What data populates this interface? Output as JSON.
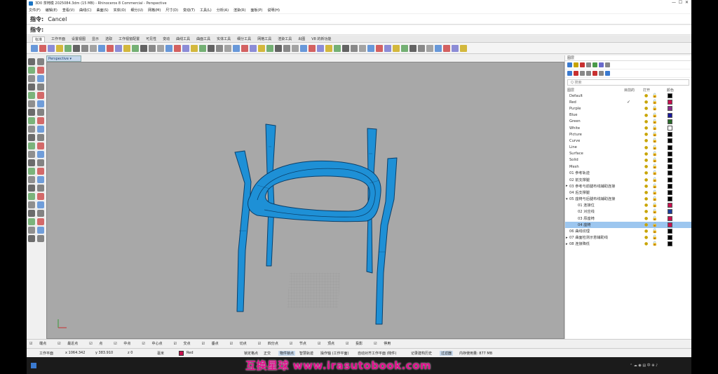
{
  "window": {
    "title": "3D0 茶椅模 2025084.3dm (15 MB) - Rhinoceros 8 Commercial - Perspective"
  },
  "menu": [
    "文件(F)",
    "编辑(E)",
    "查看(V)",
    "曲线(C)",
    "曲面(S)",
    "实体(O)",
    "细分(U)",
    "网格(M)",
    "尺寸(D)",
    "变动(T)",
    "工具(L)",
    "分析(A)",
    "渲染(R)",
    "面板(P)",
    "说明(H)"
  ],
  "command": {
    "label1": "指令:",
    "value1": "Cancel",
    "label2": "指令:"
  },
  "tabs": [
    "标准",
    "工作平面",
    "设置视图",
    "显示",
    "选取",
    "工作视窗配置",
    "可见性",
    "变动",
    "曲线工具",
    "曲面工具",
    "实体工具",
    "细分工具",
    "网格工具",
    "渲染工具",
    "出图",
    "V8 的新功能"
  ],
  "viewport": {
    "name": "Perspective"
  },
  "panel": {
    "tabs": "图层",
    "search_placeholder": "Q 搜索",
    "headers": {
      "name": "图层",
      "current": "目前的",
      "onoff": "打开",
      "color": "颜色"
    },
    "layers": [
      {
        "name": "Default",
        "current": "",
        "color": "#000000",
        "indent": 0,
        "selected": false
      },
      {
        "name": "Red",
        "current": "✓",
        "color": "#c8104e",
        "indent": 0,
        "selected": false
      },
      {
        "name": "Purple",
        "current": "",
        "color": "#8a2b8a",
        "indent": 0,
        "selected": false
      },
      {
        "name": "Blue",
        "current": "",
        "color": "#1a1a9a",
        "indent": 0,
        "selected": false
      },
      {
        "name": "Green",
        "current": "",
        "color": "#2a6a2a",
        "indent": 0,
        "selected": false
      },
      {
        "name": "White",
        "current": "",
        "color": "#ffffff",
        "indent": 0,
        "selected": false
      },
      {
        "name": "Picture",
        "current": "",
        "color": "#000000",
        "indent": 0,
        "selected": false
      },
      {
        "name": "Curve",
        "current": "",
        "color": "#000000",
        "indent": 0,
        "selected": false
      },
      {
        "name": "Line",
        "current": "",
        "color": "#000000",
        "indent": 0,
        "selected": false
      },
      {
        "name": "Surface",
        "current": "",
        "color": "#000000",
        "indent": 0,
        "selected": false
      },
      {
        "name": "Solid",
        "current": "",
        "color": "#000000",
        "indent": 0,
        "selected": false
      },
      {
        "name": "Mesh",
        "current": "",
        "color": "#000000",
        "indent": 0,
        "selected": false
      },
      {
        "name": "01 参考轨迹",
        "current": "",
        "color": "#000000",
        "indent": 0,
        "selected": false
      },
      {
        "name": "02 前支撑腿",
        "current": "",
        "color": "#000000",
        "indent": 0,
        "selected": false
      },
      {
        "name": "03 参考与前腿布线辅助连接",
        "current": "",
        "color": "#000000",
        "indent": 0,
        "selected": false,
        "arrow": "▸"
      },
      {
        "name": "04 后支撑腿",
        "current": "",
        "color": "#000000",
        "indent": 0,
        "selected": false
      },
      {
        "name": "05 座椅与后腿布线辅助连接",
        "current": "",
        "color": "#000000",
        "indent": 0,
        "selected": false,
        "arrow": "▾"
      },
      {
        "name": "01 连接位",
        "current": "",
        "color": "#c8104e",
        "indent": 1,
        "selected": false
      },
      {
        "name": "02 对应线",
        "current": "",
        "color": "#1a3d9a",
        "indent": 1,
        "selected": false
      },
      {
        "name": "03 原座椅",
        "current": "",
        "color": "#c8104e",
        "indent": 1,
        "selected": false
      },
      {
        "name": "04 座椅",
        "current": "",
        "color": "#c8104e",
        "indent": 1,
        "selected": true
      },
      {
        "name": "06 曲线纹理",
        "current": "",
        "color": "#000000",
        "indent": 0,
        "selected": false
      },
      {
        "name": "07 曲面检测示意辅助线",
        "current": "",
        "color": "#000000",
        "indent": 0,
        "selected": false,
        "arrow": "▸"
      },
      {
        "name": "08 连接降低",
        "current": "",
        "color": "#000000",
        "indent": 0,
        "selected": false,
        "arrow": "▸"
      }
    ]
  },
  "osnap": [
    "端点",
    "最近点",
    "点",
    "中点",
    "中心点",
    "交点",
    "垂点",
    "切点",
    "四分点",
    "节点",
    "顶点",
    "投影",
    "停用"
  ],
  "status": {
    "plane": "工作平面",
    "x": "x 1064.342",
    "y": "y 383.910",
    "z": "z 0",
    "unit": "毫米",
    "layer": "Red",
    "grid_snap": "锁定格点",
    "ortho": "正交",
    "planar": "物件锁点",
    "smarttrack": "智慧轨迹",
    "gumball": "操作轴 (工作平面)",
    "autoalign": "自动对齐工作平面 (物件)",
    "history": "记录建构历史",
    "filter": "过滤器",
    "memory": "内存使用量: 877 MB"
  },
  "watermark": "互换星球 www.irasutobook.com",
  "colors": {
    "chair": "#1e90d6",
    "accent": "#e10c8c"
  }
}
